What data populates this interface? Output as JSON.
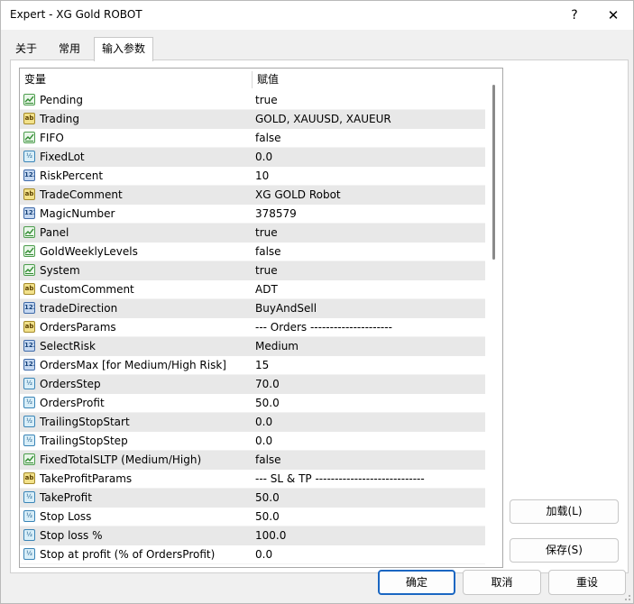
{
  "window": {
    "title": "Expert - XG Gold ROBOT",
    "help": "?",
    "close": "✕"
  },
  "tabs": [
    {
      "label": "关于"
    },
    {
      "label": "常用"
    },
    {
      "label": "输入参数"
    }
  ],
  "grid": {
    "headers": {
      "variable": "变量",
      "value": "赋值"
    },
    "rows": [
      {
        "name": "Pending",
        "value": "true",
        "type": "bool"
      },
      {
        "name": "Trading",
        "value": "GOLD, XAUUSD, XAUEUR",
        "type": "string"
      },
      {
        "name": "FIFO",
        "value": "false",
        "type": "bool"
      },
      {
        "name": "FixedLot",
        "value": "0.0",
        "type": "double"
      },
      {
        "name": "RiskPercent",
        "value": "10",
        "type": "int"
      },
      {
        "name": "TradeComment",
        "value": "XG GOLD Robot",
        "type": "string"
      },
      {
        "name": "MagicNumber",
        "value": "378579",
        "type": "int"
      },
      {
        "name": "Panel",
        "value": "true",
        "type": "bool"
      },
      {
        "name": "GoldWeeklyLevels",
        "value": "false",
        "type": "bool"
      },
      {
        "name": "System",
        "value": "true",
        "type": "bool"
      },
      {
        "name": "CustomComment",
        "value": "ADT",
        "type": "string"
      },
      {
        "name": "tradeDirection",
        "value": "BuyAndSell",
        "type": "int"
      },
      {
        "name": "OrdersParams",
        "value": "--- Orders ---------------------",
        "type": "string"
      },
      {
        "name": "SelectRisk",
        "value": "Medium",
        "type": "int"
      },
      {
        "name": "OrdersMax [for Medium/High Risk]",
        "value": "15",
        "type": "int"
      },
      {
        "name": "OrdersStep",
        "value": "70.0",
        "type": "double"
      },
      {
        "name": "OrdersProfit",
        "value": "50.0",
        "type": "double"
      },
      {
        "name": "TrailingStopStart",
        "value": "0.0",
        "type": "double"
      },
      {
        "name": "TrailingStopStep",
        "value": "0.0",
        "type": "double"
      },
      {
        "name": "FixedTotalSLTP (Medium/High)",
        "value": "false",
        "type": "bool"
      },
      {
        "name": "TakeProfitParams",
        "value": "--- SL & TP ----------------------------",
        "type": "string"
      },
      {
        "name": "TakeProfit",
        "value": "50.0",
        "type": "double"
      },
      {
        "name": "Stop Loss",
        "value": "50.0",
        "type": "double"
      },
      {
        "name": "Stop loss %",
        "value": "100.0",
        "type": "double"
      },
      {
        "name": "Stop at profit (% of OrdersProfit)",
        "value": "0.0",
        "type": "double"
      }
    ]
  },
  "icons": {
    "string": "ab",
    "int": "123",
    "double": "½",
    "bool": "toggle-icon"
  },
  "side_buttons": {
    "load": "加载(L)",
    "save": "保存(S)"
  },
  "footer_buttons": {
    "ok": "确定",
    "cancel": "取消",
    "reset": "重设"
  },
  "colors": {
    "primary_border": "#1a66c2",
    "alt_row": "#e8e8e8"
  }
}
